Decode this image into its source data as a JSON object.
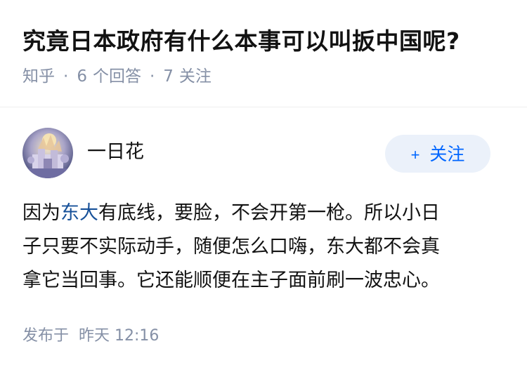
{
  "question": {
    "title": "究竟日本政府有什么本事可以叫扳中国呢?",
    "source": "知乎",
    "answer_count": "6",
    "answer_label": "个回答",
    "follow_count": "7",
    "follow_label": "关注",
    "separator": "·"
  },
  "author": {
    "name": "一日花",
    "follow_button_label": "关注",
    "follow_icon": "plus-icon"
  },
  "answer": {
    "line1_before": "因为",
    "line1_link": "东大",
    "line1_after": "有底线，要脸，不会开第一枪。所以小日",
    "line2": "子只要不实际动手，随便怎么口嗨，东大都不会真",
    "line3": "拿它当回事。它还能顺便在主子面前刷一波忠心。"
  },
  "footer": {
    "published_label": "发布于",
    "published_time": "昨天 12:16"
  },
  "colors": {
    "brand_blue": "#0066ff",
    "link_blue": "#175199",
    "meta_gray": "#8590a6",
    "button_bg": "#ebf1fa"
  }
}
